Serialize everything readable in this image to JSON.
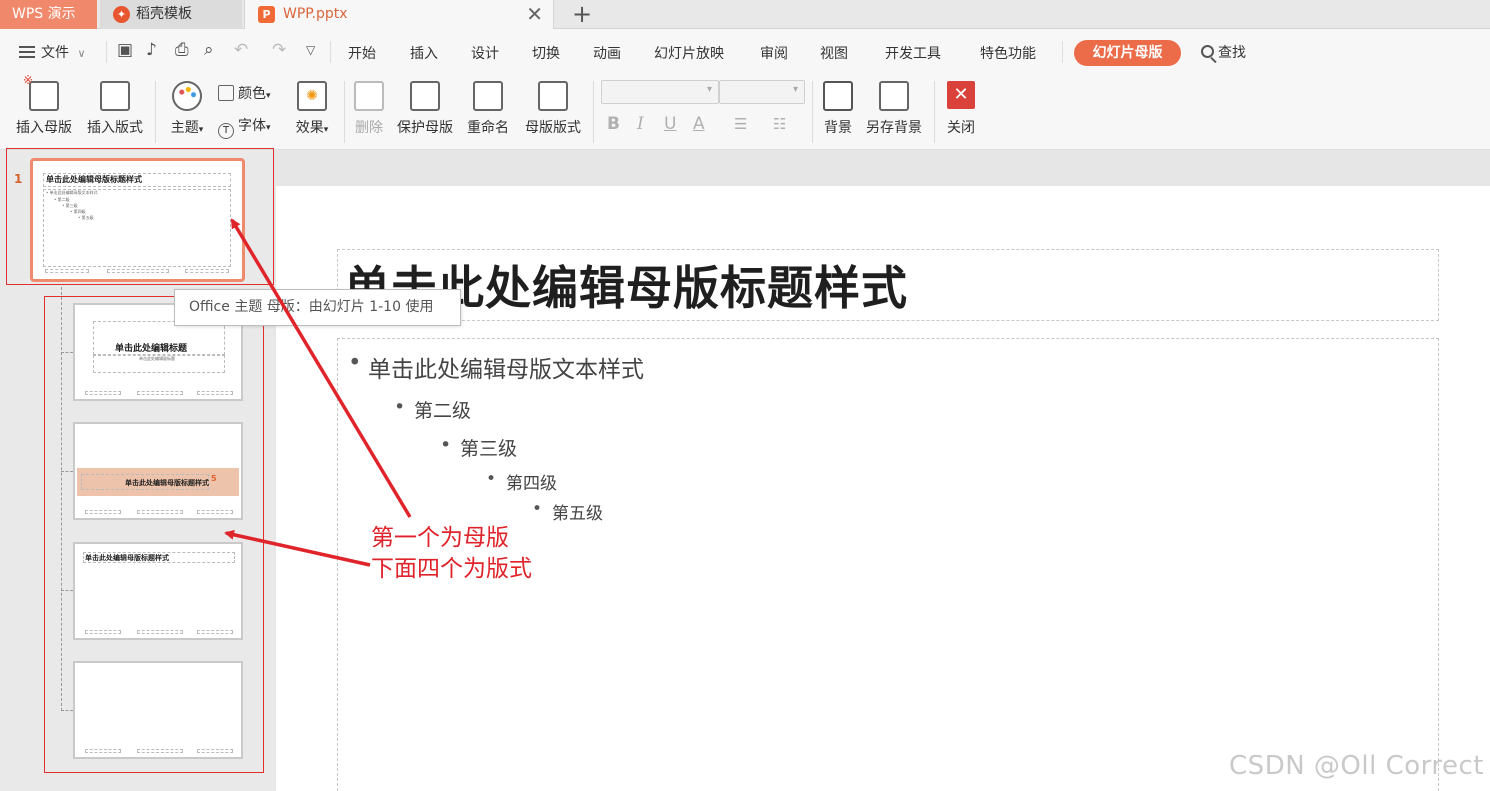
{
  "tabs": {
    "app": "WPS 演示",
    "templates": "稻壳模板",
    "document": "WPP.pptx",
    "doc_logo": "P"
  },
  "menu": {
    "file": "文件",
    "items": [
      "开始",
      "插入",
      "设计",
      "切换",
      "动画",
      "幻灯片放映",
      "审阅",
      "视图",
      "开发工具",
      "特色功能"
    ],
    "active": "幻灯片母版",
    "search": "查找"
  },
  "ribbon": {
    "insert_master": "插入母版",
    "insert_layout": "插入版式",
    "theme": "主题",
    "color": "颜色",
    "font": "字体",
    "effect": "效果",
    "delete": "删除",
    "protect_master": "保护母版",
    "rename": "重命名",
    "master_layout": "母版版式",
    "background": "背景",
    "save_background": "另存背景",
    "close": "关闭",
    "format_bold": "B",
    "format_italic": "I",
    "format_underline": "U",
    "format_fontcolor": "A"
  },
  "panel": {
    "slide_number": "1",
    "master_thumb_title": "单击此处编辑母版标题样式",
    "master_thumb_body": [
      "• 单击此处编辑母版文本样式",
      "• 第二级",
      "• 第三级",
      "• 第四级",
      "• 第五级"
    ],
    "layout1_title": "单击此处编辑标题",
    "layout1_sub": "单击此处编辑副标题",
    "layout2_title": "单击此处编辑母版标题样式",
    "layout3_title": "单击此处编辑母版标题样式"
  },
  "tooltip": "Office 主题 母版：由幻灯片 1-10 使用",
  "slide": {
    "title": "单击此处编辑母版标题样式",
    "levels": [
      "单击此处编辑母版文本样式",
      "第二级",
      "第三级",
      "第四级",
      "第五级"
    ]
  },
  "annotation": {
    "line1": "第一个为母版",
    "line2": "下面四个为版式"
  },
  "watermark": "CSDN @Oll Correct",
  "colors": {
    "accent": "#ec6c49",
    "annotation": "#e0242b",
    "app_tab": "#f0896b"
  }
}
